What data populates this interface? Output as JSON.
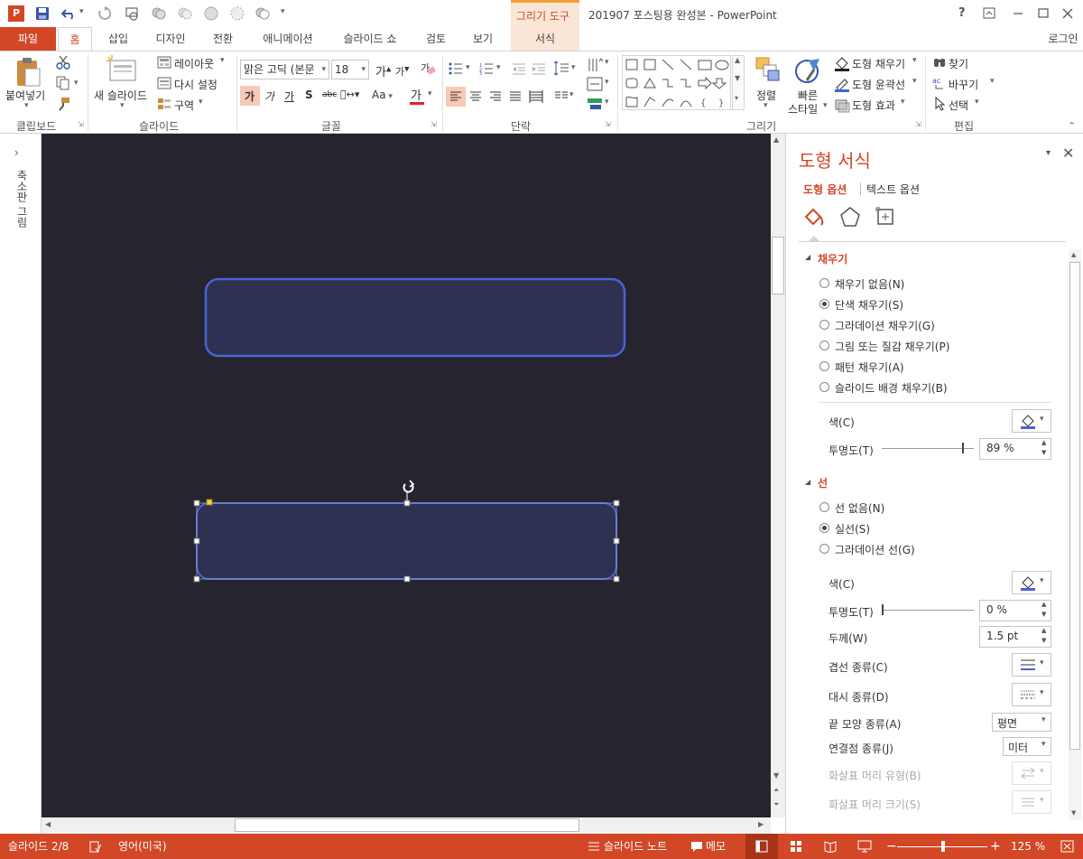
{
  "window": {
    "title": "201907 포스팅용 완성본 - PowerPoint",
    "contextual_tab_group": "그리기 도구",
    "help": "?",
    "login": "로그인"
  },
  "tabs": [
    "파일",
    "홈",
    "삽입",
    "디자인",
    "전환",
    "애니메이션",
    "슬라이드 쇼",
    "검토",
    "보기",
    "서식"
  ],
  "ribbon": {
    "clipboard": {
      "paste": "붙여넣기",
      "group": "클립보드"
    },
    "slides": {
      "new_slide": "새 슬라이드",
      "layout": "레이아웃",
      "reset": "다시 설정",
      "section": "구역",
      "group": "슬라이드"
    },
    "font": {
      "name": "맑은 고딕 (본문",
      "size": "18",
      "group": "글꼴",
      "case": "Aa"
    },
    "paragraph": {
      "group": "단락"
    },
    "drawing": {
      "arrange": "정렬",
      "quick_styles": "빠른",
      "quick_styles2": "스타일",
      "shape_fill": "도형 채우기",
      "shape_outline": "도형 윤곽선",
      "shape_effects": "도형 효과",
      "group": "그리기"
    },
    "editing": {
      "find": "찾기",
      "replace": "바꾸기",
      "select": "선택",
      "group": "편집"
    }
  },
  "left_pane": {
    "label": "축소판 그림"
  },
  "format_pane": {
    "title": "도형 서식",
    "tab_shape": "도형 옵션",
    "tab_text": "텍스트 옵션",
    "fill": {
      "header": "채우기",
      "options": [
        "채우기 없음(N)",
        "단색 채우기(S)",
        "그라데이션 채우기(G)",
        "그림 또는 질감 채우기(P)",
        "패턴 채우기(A)",
        "슬라이드 배경 채우기(B)"
      ],
      "selected_index": 1,
      "color_label": "색(C)",
      "transparency_label": "투명도(T)",
      "transparency_value": "89 %",
      "transparency_fraction": 0.89
    },
    "line": {
      "header": "선",
      "options": [
        "선 없음(N)",
        "실선(S)",
        "그라데이션 선(G)"
      ],
      "selected_index": 1,
      "color_label": "색(C)",
      "transparency_label": "투명도(T)",
      "transparency_value": "0 %",
      "transparency_fraction": 0.0,
      "width_label": "두께(W)",
      "width_value": "1.5 pt",
      "compound_label": "겹선 종류(C)",
      "dash_label": "대시 종류(D)",
      "cap_label": "끝 모양 종류(A)",
      "cap_value": "평면",
      "join_label": "연결점 종류(J)",
      "join_value": "미터",
      "arrow_type_label": "화살표 머리 유형(B)",
      "arrow_size_label": "화살표 머리 크기(S)"
    }
  },
  "status": {
    "slide": "슬라이드 2/8",
    "language": "영어(미국)",
    "notes": "슬라이드 노트",
    "comments": "메모",
    "zoom": "125 %"
  },
  "colors": {
    "accent": "#d24726",
    "slide_bg": "#25242f",
    "shape_fill": "#2e3151",
    "shape_line": "#4a63d4"
  }
}
